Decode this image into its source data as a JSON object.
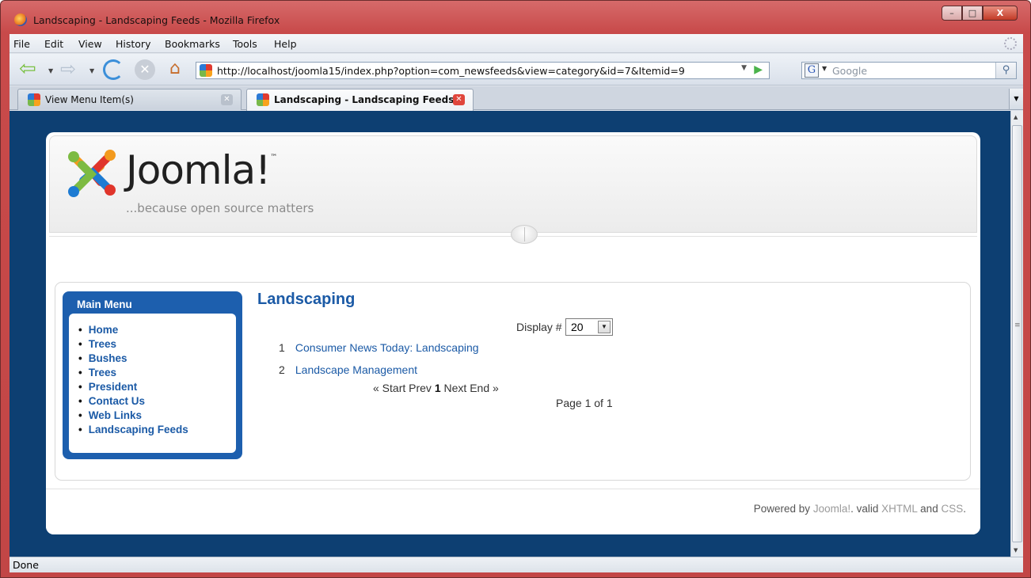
{
  "window": {
    "title": "Landscaping - Landscaping Feeds - Mozilla Firefox",
    "buttons": {
      "minimize": "–",
      "maximize": "□",
      "close": "X"
    }
  },
  "menubar": {
    "items": [
      "File",
      "Edit",
      "View",
      "History",
      "Bookmarks",
      "Tools",
      "Help"
    ]
  },
  "navbar": {
    "url": "http://localhost/joomla15/index.php?option=com_newsfeeds&view=category&id=7&Itemid=9",
    "search_engine": "G",
    "search_placeholder": "Google"
  },
  "tabs": [
    {
      "label": "View Menu Item(s)",
      "active": false
    },
    {
      "label": "Landscaping - Landscaping Feeds",
      "active": true
    }
  ],
  "site": {
    "logo_text": "Joomla!",
    "logo_tm": "™",
    "tagline": "...because open source matters"
  },
  "main_menu": {
    "title": "Main Menu",
    "items": [
      "Home",
      "Trees",
      "Bushes",
      "Trees",
      "President",
      "Contact Us",
      "Web Links",
      "Landscaping Feeds"
    ]
  },
  "content": {
    "title": "Landscaping",
    "display_label": "Display #",
    "display_value": "20",
    "feeds": [
      {
        "num": "1",
        "title": "Consumer News Today: Landscaping"
      },
      {
        "num": "2",
        "title": "Landscape Management"
      }
    ],
    "pager": {
      "start": "« Start",
      "prev": "Prev",
      "current": "1",
      "next": "Next",
      "end": "End »"
    },
    "page_count": "Page 1 of 1"
  },
  "footer": {
    "powered_by": "Powered by",
    "joomla": "Joomla!",
    "valid": ". valid",
    "xhtml": "XHTML",
    "and": "and",
    "css": "CSS",
    "dot": "."
  },
  "status": {
    "text": "Done"
  },
  "colors": {
    "page_bg": "#0d3f72",
    "accent_blue": "#1b5aa6",
    "menu_box": "#1d5fae",
    "title_bar": "#c84a4a"
  }
}
